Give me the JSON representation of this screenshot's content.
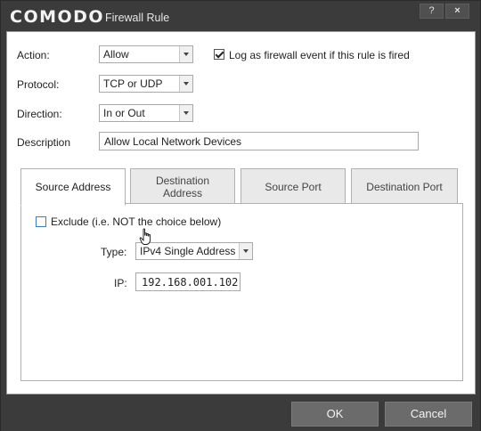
{
  "window": {
    "brand": "COMODO",
    "title": "Firewall Rule",
    "help_label": "?",
    "close_label": "×"
  },
  "form": {
    "action_label": "Action:",
    "action_value": "Allow",
    "log_label": "Log as firewall event if this rule is fired",
    "log_checked": true,
    "protocol_label": "Protocol:",
    "protocol_value": "TCP or UDP",
    "direction_label": "Direction:",
    "direction_value": "In or Out",
    "description_label": "Description",
    "description_value": "Allow Local Network Devices"
  },
  "tabs": [
    {
      "label": "Source Address",
      "active": true
    },
    {
      "label": "Destination Address",
      "active": false
    },
    {
      "label": "Source Port",
      "active": false
    },
    {
      "label": "Destination Port",
      "active": false
    }
  ],
  "tab_labels": {
    "source_address": "Source Address",
    "destination_line1": "Destination",
    "destination_line2": "Address",
    "source_port": "Source Port",
    "destination_port": "Destination Port"
  },
  "source": {
    "exclude_label": "Exclude (i.e. NOT the choice below)",
    "exclude_checked": false,
    "type_label": "Type:",
    "type_value": "IPv4 Single Address",
    "ip_label": "IP:",
    "ip_value": "192.168.001.102"
  },
  "footer": {
    "ok_label": "OK",
    "cancel_label": "Cancel"
  },
  "colors": {
    "chrome": "#3b3b3b",
    "button": "#6b6b6b",
    "checkbox_accent": "#3d7cc9"
  },
  "icons": {
    "cursor": "hand-pointer-icon",
    "dropdown": "chevron-down-icon",
    "check": "checkmark-icon"
  }
}
